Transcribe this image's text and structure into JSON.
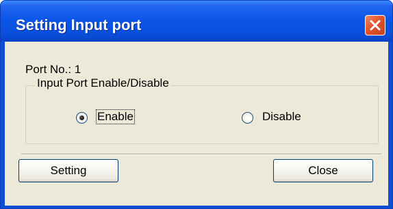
{
  "window": {
    "title": "Setting Input port"
  },
  "port": {
    "label": "Port No.: 1"
  },
  "group": {
    "legend": "Input Port Enable/Disable",
    "options": [
      {
        "label": "Enable",
        "selected": true
      },
      {
        "label": "Disable",
        "selected": false
      }
    ]
  },
  "buttons": {
    "setting_label": "Setting",
    "close_label": "Close"
  },
  "colors": {
    "titlebar": "#0a4fdc",
    "client_bg": "#ece9d8",
    "close_button": "#e2552d"
  },
  "icons": {
    "close": "close-icon"
  }
}
